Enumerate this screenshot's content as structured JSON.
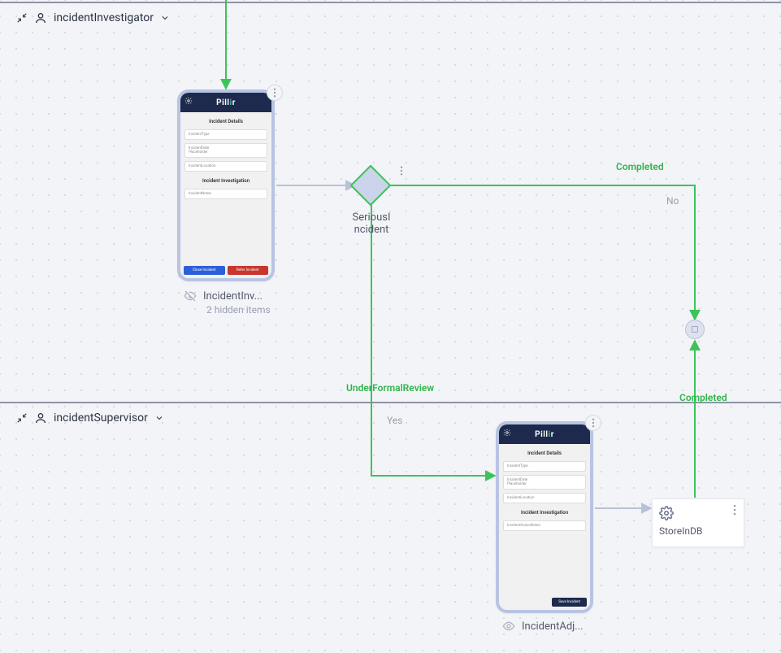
{
  "lanes": {
    "top": {
      "name": "incidentInvestigator"
    },
    "bottom": {
      "name": "incidentSupervisor"
    }
  },
  "nodes": {
    "form1": {
      "brand": "Pill",
      "brand_suffix": "r",
      "title": "Incident Details",
      "fields": [
        "IncidentType",
        "IncidentDate\nPlaceholder",
        "IncidentLocation"
      ],
      "section": "Incident Investigation",
      "fields2": [
        "IncidentNotes"
      ],
      "buttons": {
        "primary": "Close Incident",
        "danger": "Refer Incident"
      },
      "label": "IncidentInv...",
      "sublabel": "2 hidden items"
    },
    "gateway": {
      "label": "SeriousI\nncident"
    },
    "form2": {
      "brand": "Pill",
      "brand_suffix": "r",
      "title": "Incident Details",
      "fields": [
        "IncidentType",
        "IncidentDate\nPlaceholder",
        "IncidentLocation"
      ],
      "section": "Incident Investigation",
      "fields2": [
        "IncidentActionNotes"
      ],
      "buttons": {
        "save": "Save Incident"
      },
      "label": "IncidentAdj..."
    },
    "service": {
      "label": "StoreInDB"
    }
  },
  "edges": {
    "completed1": "Completed",
    "no": "No",
    "underFormal": "UnderFormalReview",
    "yes": "Yes",
    "completed2": "Completed"
  }
}
